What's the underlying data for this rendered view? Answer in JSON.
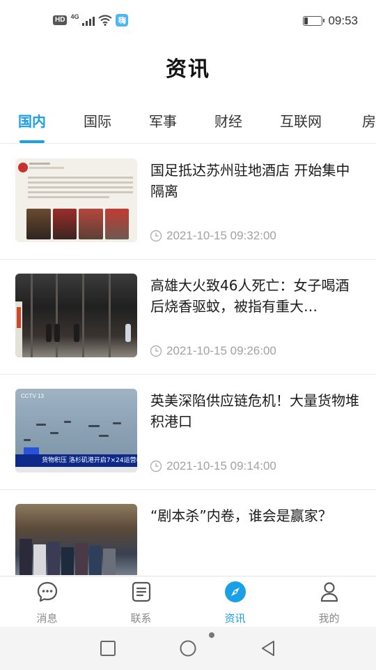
{
  "status_bar": {
    "hd_label": "HD",
    "network_label": "4G",
    "app_badge": "嗨",
    "battery_level_pct": 20,
    "time": "09:53"
  },
  "header": {
    "title": "资讯"
  },
  "tabs": [
    {
      "label": "国内",
      "active": true
    },
    {
      "label": "国际",
      "active": false
    },
    {
      "label": "军事",
      "active": false
    },
    {
      "label": "财经",
      "active": false
    },
    {
      "label": "互联网",
      "active": false
    },
    {
      "label": "房",
      "active": false
    }
  ],
  "news": [
    {
      "title": "国足抵达苏州驻地酒店 开始集中隔离",
      "time": "2021-10-15 09:32:00",
      "thumbnail": "social-post-screenshot"
    },
    {
      "title": "高雄大火致46人死亡：女子喝酒后烧香驱蚊，被指有重大…",
      "time": "2021-10-15 09:26:00",
      "thumbnail": "burned-building-interior"
    },
    {
      "title": "英美深陷供应链危机！大量货物堆积港口",
      "time": "2021-10-15 09:14:00",
      "thumbnail": "news-broadcast-port",
      "thumbnail_caption": "货物积压 洛杉矶港开启7×24运营模式",
      "thumbnail_logo": "CCTV 13"
    },
    {
      "title": "“剧本杀”内卷，谁会是赢家？",
      "time": "",
      "thumbnail": "shop-posters"
    }
  ],
  "bottom_nav": [
    {
      "label": "消息",
      "icon": "chat-bubble-icon",
      "active": false
    },
    {
      "label": "联系",
      "icon": "contacts-list-icon",
      "active": false
    },
    {
      "label": "资讯",
      "icon": "compass-icon",
      "active": true
    },
    {
      "label": "我的",
      "icon": "person-icon",
      "active": false
    }
  ],
  "colors": {
    "accent": "#1aa0e6",
    "text_primary": "#1a1a1a",
    "text_muted": "#a2a2a2",
    "nav_inactive": "#8a8a8a"
  }
}
